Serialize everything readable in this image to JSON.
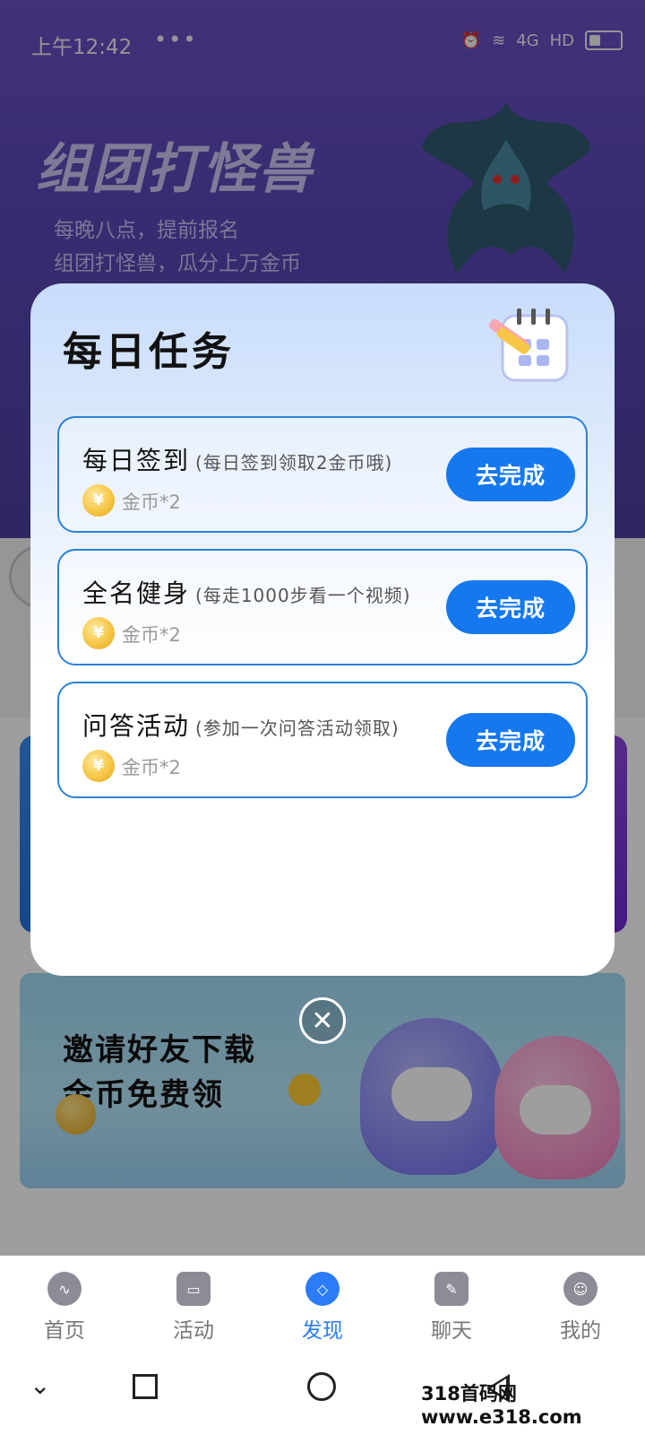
{
  "status_bar": {
    "time": "上午12:42",
    "more": "•••",
    "network": "4G",
    "hd": "HD"
  },
  "background": {
    "hero_title": "组团打怪兽",
    "hero_subtitle_1": "每晚八点，提前报名",
    "hero_subtitle_2": "组团打怪兽，瓜分上万金币",
    "banner_line_1": "邀请好友下载",
    "banner_line_2": "金币免费领"
  },
  "modal": {
    "title": "每日任务",
    "tasks": [
      {
        "name": "每日签到",
        "desc": "(每日签到领取2金币哦)",
        "reward": "金币*2",
        "button": "去完成"
      },
      {
        "name": "全名健身",
        "desc": "(每走1000步看一个视频)",
        "reward": "金币*2",
        "button": "去完成"
      },
      {
        "name": "问答活动",
        "desc": "(参加一次问答活动领取)",
        "reward": "金币*2",
        "button": "去完成"
      }
    ],
    "close_icon": "close-icon"
  },
  "tabbar": {
    "items": [
      {
        "label": "首页",
        "icon": "voice-wave-icon",
        "active": false
      },
      {
        "label": "活动",
        "icon": "monitor-icon",
        "active": false
      },
      {
        "label": "发现",
        "icon": "compass-icon",
        "active": true
      },
      {
        "label": "聊天",
        "icon": "chat-icon",
        "active": false
      },
      {
        "label": "我的",
        "icon": "smile-icon",
        "active": false
      }
    ]
  },
  "watermark": "318首码网 www.e318.com",
  "colors": {
    "accent": "#1578ee",
    "task_border": "#2a82d8",
    "tab_active": "#2b7cf6"
  }
}
